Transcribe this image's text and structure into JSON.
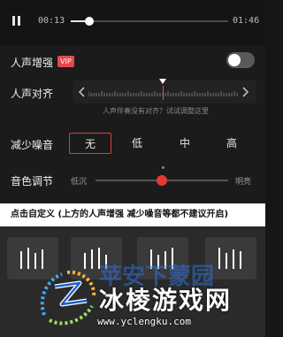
{
  "player": {
    "time_current": "00:13",
    "time_total": "01:46",
    "progress": 0.12
  },
  "vocal_enhance": {
    "label": "人声增强",
    "badge": "VIP",
    "enabled": false
  },
  "vocal_align": {
    "label": "人声对齐",
    "hint": "人声伴奏没有对齐？试试调整这里"
  },
  "noise_reduce": {
    "label": "减少噪音",
    "options": [
      "无",
      "低",
      "中",
      "高"
    ],
    "selected": "无"
  },
  "tone": {
    "label": "音色调节",
    "low_label": "低沉",
    "high_label": "明亮",
    "value": 0.5
  },
  "caption": "点击自定义  (上方的人声增强  减少噪音等都不建议开启)",
  "watermark": {
    "title": "冰棱游戏网",
    "url": "www.yclengku.com",
    "faded_text": "苹安下蒙园"
  },
  "colors": {
    "accent": "#e53935",
    "vip": "#e8474d"
  }
}
